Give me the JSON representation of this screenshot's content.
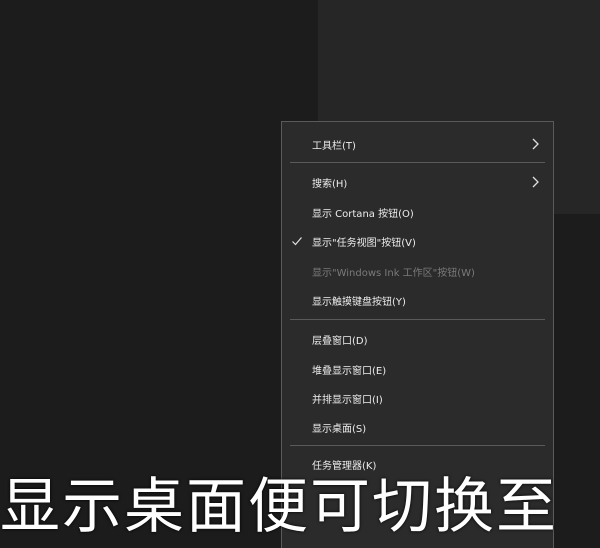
{
  "context_menu": {
    "items": [
      {
        "label": "工具栏(T)",
        "submenu": true,
        "checked": false,
        "disabled": false
      },
      {
        "label": "搜索(H)",
        "submenu": true,
        "checked": false,
        "disabled": false
      },
      {
        "label": "显示 Cortana 按钮(O)",
        "submenu": false,
        "checked": false,
        "disabled": false
      },
      {
        "label": "显示\"任务视图\"按钮(V)",
        "submenu": false,
        "checked": true,
        "disabled": false
      },
      {
        "label": "显示\"Windows Ink 工作区\"按钮(W)",
        "submenu": false,
        "checked": false,
        "disabled": true
      },
      {
        "label": "显示触摸键盘按钮(Y)",
        "submenu": false,
        "checked": false,
        "disabled": false
      },
      {
        "label": "层叠窗口(D)",
        "submenu": false,
        "checked": false,
        "disabled": false
      },
      {
        "label": "堆叠显示窗口(E)",
        "submenu": false,
        "checked": false,
        "disabled": false
      },
      {
        "label": "并排显示窗口(I)",
        "submenu": false,
        "checked": false,
        "disabled": false
      },
      {
        "label": "显示桌面(S)",
        "submenu": false,
        "checked": false,
        "disabled": false
      },
      {
        "label": "任务管理器(K)",
        "submenu": false,
        "checked": false,
        "disabled": false
      }
    ]
  },
  "caption": {
    "text": "显示桌面便可切换至"
  },
  "colors": {
    "menu_bg": "#2b2b2b",
    "menu_border": "#5a5a5a",
    "text": "#ededed",
    "disabled_text": "#7a7a7a"
  },
  "icons": {
    "submenu": "chevron-right-icon",
    "checked": "checkmark-icon"
  }
}
